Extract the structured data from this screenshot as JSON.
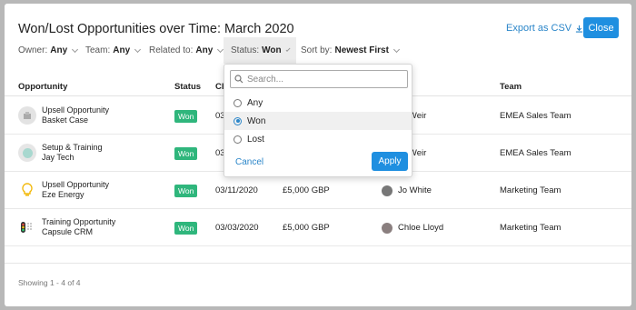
{
  "modal": {
    "title": "Won/Lost Opportunities over Time: March 2020",
    "export_label": "Export as CSV",
    "close_label": "Close"
  },
  "filters": {
    "owner": {
      "label": "Owner:",
      "value": "Any"
    },
    "team": {
      "label": "Team:",
      "value": "Any"
    },
    "related": {
      "label": "Related to:",
      "value": "Any"
    },
    "status": {
      "label": "Status:",
      "value": "Won"
    },
    "sort": {
      "label": "Sort by:",
      "value": "Newest First"
    }
  },
  "table": {
    "headers": {
      "opportunity": "Opportunity",
      "status": "Status",
      "closed": "Cl",
      "team": "Team"
    },
    "rows": [
      {
        "name1": "Upsell Opportunity",
        "name2": "Basket Case",
        "status": "Won",
        "date": "03",
        "value": "",
        "owner": "n Weir",
        "team": "EMEA Sales Team"
      },
      {
        "name1": "Setup & Training",
        "name2": "Jay Tech",
        "status": "Won",
        "date": "03",
        "value": "",
        "owner": "n Weir",
        "team": "EMEA Sales Team"
      },
      {
        "name1": "Upsell Opportunity",
        "name2": "Eze Energy",
        "status": "Won",
        "date": "03/11/2020",
        "value": "£5,000 GBP",
        "owner": "Jo White",
        "team": "Marketing Team"
      },
      {
        "name1": "Training Opportunity",
        "name2": "Capsule CRM",
        "status": "Won",
        "date": "03/03/2020",
        "value": "£5,000 GBP",
        "owner": "Chloe Lloyd",
        "team": "Marketing Team"
      }
    ]
  },
  "footer": {
    "showing": "Showing 1 - 4 of 4"
  },
  "dropdown": {
    "search_placeholder": "Search...",
    "options": [
      "Any",
      "Won",
      "Lost"
    ],
    "selected": "Won",
    "cancel_label": "Cancel",
    "apply_label": "Apply"
  },
  "colors": {
    "accent": "#1f8fe0",
    "won_badge": "#2fb67c"
  }
}
